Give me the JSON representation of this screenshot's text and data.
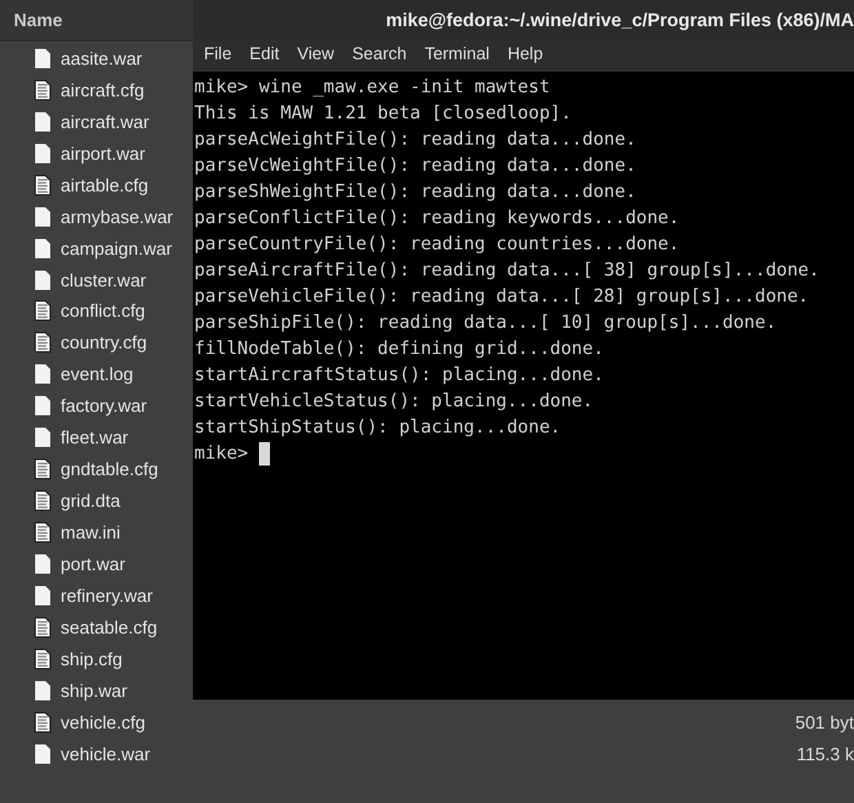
{
  "file_list": {
    "columns": [
      {
        "label": "Name"
      }
    ],
    "rows": [
      {
        "name": "aasite.war",
        "kind": "plain"
      },
      {
        "name": "aircraft.cfg",
        "kind": "text"
      },
      {
        "name": "aircraft.war",
        "kind": "plain"
      },
      {
        "name": "airport.war",
        "kind": "plain"
      },
      {
        "name": "airtable.cfg",
        "kind": "text"
      },
      {
        "name": "armybase.war",
        "kind": "plain"
      },
      {
        "name": "campaign.war",
        "kind": "plain"
      },
      {
        "name": "cluster.war",
        "kind": "plain"
      },
      {
        "name": "conflict.cfg",
        "kind": "text"
      },
      {
        "name": "country.cfg",
        "kind": "text"
      },
      {
        "name": "event.log",
        "kind": "plain"
      },
      {
        "name": "factory.war",
        "kind": "plain"
      },
      {
        "name": "fleet.war",
        "kind": "plain"
      },
      {
        "name": "gndtable.cfg",
        "kind": "text"
      },
      {
        "name": "grid.dta",
        "kind": "text"
      },
      {
        "name": "maw.ini",
        "kind": "text"
      },
      {
        "name": "port.war",
        "kind": "plain"
      },
      {
        "name": "refinery.war",
        "kind": "plain"
      },
      {
        "name": "seatable.cfg",
        "kind": "text"
      },
      {
        "name": "ship.cfg",
        "kind": "text"
      },
      {
        "name": "ship.war",
        "kind": "plain"
      },
      {
        "name": "vehicle.cfg",
        "kind": "text",
        "size": "501 byt"
      },
      {
        "name": "vehicle.war",
        "kind": "plain",
        "size": "115.3 k"
      }
    ]
  },
  "terminal": {
    "title": "mike@fedora:~/.wine/drive_c/Program Files (x86)/MA",
    "menu": [
      "File",
      "Edit",
      "View",
      "Search",
      "Terminal",
      "Help"
    ],
    "lines": [
      "mike> wine _maw.exe -init mawtest",
      "This is MAW 1.21 beta [closedloop].",
      "parseAcWeightFile(): reading data...done.",
      "parseVcWeightFile(): reading data...done.",
      "parseShWeightFile(): reading data...done.",
      "parseConflictFile(): reading keywords...done.",
      "parseCountryFile(): reading countries...done.",
      "parseAircraftFile(): reading data...[ 38] group[s]...done.",
      "parseVehicleFile(): reading data...[ 28] group[s]...done.",
      "parseShipFile(): reading data...[ 10] group[s]...done.",
      "fillNodeTable(): defining grid...done.",
      "startAircraftStatus(): placing...done.",
      "startVehicleStatus(): placing...done.",
      "startShipStatus(): placing...done."
    ],
    "prompt": "mike>"
  }
}
